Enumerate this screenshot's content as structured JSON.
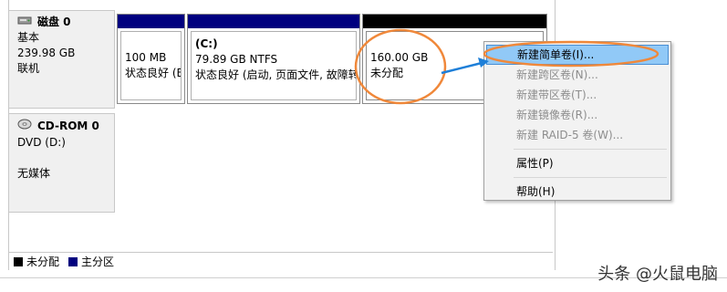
{
  "disks": [
    {
      "name": "磁盘 0",
      "type": "基本",
      "size": "239.98 GB",
      "status": "联机"
    },
    {
      "name": "CD-ROM 0",
      "type": "DVD (D:)",
      "media": "无媒体"
    }
  ],
  "partitions": [
    {
      "size": "100 MB",
      "status": "状态良好 (E"
    },
    {
      "label": "(C:)",
      "size": "79.89 GB NTFS",
      "status": "状态良好 (启动, 页面文件, 故障转"
    },
    {
      "size": "160.00 GB",
      "status": "未分配"
    }
  ],
  "menu": {
    "items": [
      {
        "label": "新建简单卷(I)...",
        "enabled": true
      },
      {
        "label": "新建跨区卷(N)...",
        "enabled": false
      },
      {
        "label": "新建带区卷(T)...",
        "enabled": false
      },
      {
        "label": "新建镜像卷(R)...",
        "enabled": false
      },
      {
        "label": "新建 RAID-5 卷(W)...",
        "enabled": false
      },
      {
        "label": "属性(P)",
        "enabled": true
      },
      {
        "label": "帮助(H)",
        "enabled": true
      }
    ]
  },
  "legend": {
    "unallocated": "未分配",
    "primary": "主分区"
  },
  "watermark": "头条 @火鼠电脑",
  "colors": {
    "primary_bar": "#00007f",
    "unallocated_bar": "#000000",
    "highlight": "#91c9f7",
    "annotation": "#f0883a",
    "arrow": "#1e7fd8"
  }
}
